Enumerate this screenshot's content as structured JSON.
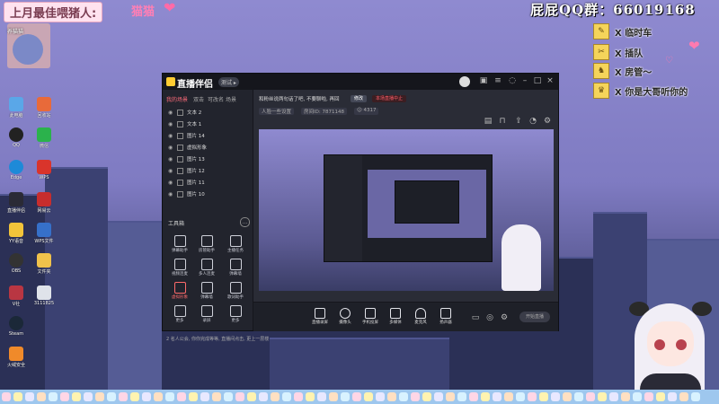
{
  "banner": {
    "title": "上月最佳喂猪人:",
    "nick": "猫猫",
    "heart": "❤"
  },
  "qq_group": "屁屁QQ群：66019168",
  "notices": [
    {
      "icon": "✎",
      "text": "X 临时车"
    },
    {
      "icon": "✂",
      "text": "X 插队"
    },
    {
      "icon": "♞",
      "text": "X 房管～"
    },
    {
      "icon": "♛",
      "text": "X 你是大哥听你的"
    }
  ],
  "sticker_label": "养猫猫",
  "desktop_icons": [
    {
      "label": "此电脑"
    },
    {
      "label": "回收站"
    },
    {
      "label": "QQ"
    },
    {
      "label": "微信"
    },
    {
      "label": "Edge"
    },
    {
      "label": "WPS"
    },
    {
      "label": "直播伴侣"
    },
    {
      "label": "网易云"
    },
    {
      "label": "YY语音"
    },
    {
      "label": "WPS文件"
    },
    {
      "label": "OBS"
    },
    {
      "label": "文件夹"
    },
    {
      "label": "V社"
    },
    {
      "label": "3111825"
    },
    {
      "label": "Steam"
    },
    {
      "label": "火绒安全"
    }
  ],
  "app": {
    "name": "直播伴侣",
    "version": "测试 ▸",
    "tabs": [
      "我的场景",
      "双击",
      "可改名",
      "场景"
    ],
    "sources": [
      "文本 2",
      "文本 1",
      "图片 14",
      "虚拟形象",
      "图片 13",
      "图片 12",
      "图片 11",
      "图片 10"
    ],
    "tools_label": "工具箱",
    "tools": [
      {
        "label": "弹幕助手"
      },
      {
        "label": "房管助手"
      },
      {
        "label": "主播任务"
      },
      {
        "label": "视频连麦"
      },
      {
        "label": "多人连麦"
      },
      {
        "label": "弹幕墙"
      },
      {
        "label": "虚拟形象"
      },
      {
        "label": "弹幕墙"
      },
      {
        "label": "歌词助手"
      },
      {
        "label": "更多"
      },
      {
        "label": "录屏"
      },
      {
        "label": "更多"
      }
    ],
    "status": "2 名人公会, 你你完成等等, 直播间点击, 更上一层楼",
    "notice_text": "和粉丝说两句话了吧, 不要聊啦, 再回",
    "notice_btn": "修改",
    "live_tag": "本场直播中止",
    "room": [
      "人脸一些设置",
      "房间ID: 7871148",
      "☺ 4317"
    ],
    "controls": [
      {
        "label": "直播录屏"
      },
      {
        "label": "摄像头"
      },
      {
        "label": "手机投屏"
      },
      {
        "label": "多媒体"
      },
      {
        "label": "麦克风"
      },
      {
        "label": "扬声器"
      }
    ],
    "start_label": "开始直播"
  }
}
